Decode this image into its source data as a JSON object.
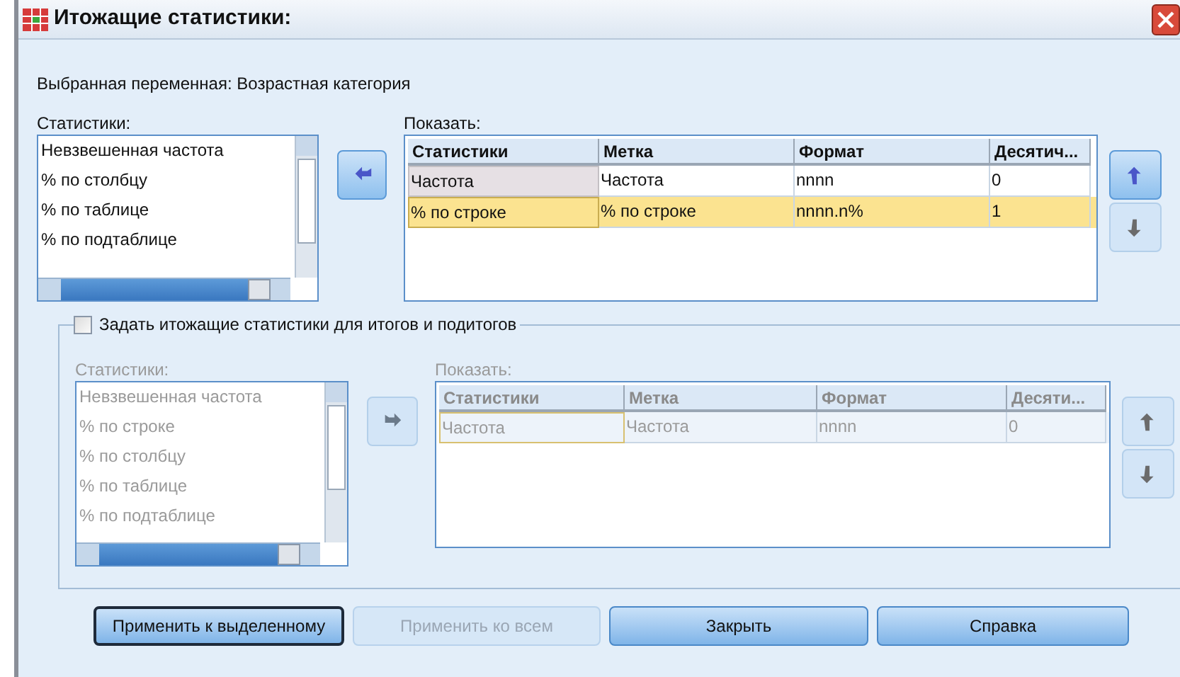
{
  "window": {
    "title": "Итожащие статистики:"
  },
  "selected_variable": "Выбранная переменная: Возрастная категория",
  "main": {
    "list_label": "Статистики:",
    "list_items": [
      "Невзвешенная частота",
      "% по столбцу",
      "% по таблице",
      "% по подтаблице"
    ],
    "table_label": "Показать:",
    "columns": [
      "Статистики",
      "Метка",
      "Формат",
      "Десятич..."
    ],
    "rows": [
      {
        "cells": [
          "Частота",
          "Частота",
          "nnnn",
          "0"
        ],
        "selected": false
      },
      {
        "cells": [
          "% по строке",
          "% по строке",
          "nnnn.n%",
          "1"
        ],
        "selected": true
      }
    ],
    "move_buttons": [
      {
        "kind": "up",
        "disabled": false
      },
      {
        "kind": "down",
        "disabled": true
      }
    ]
  },
  "subtotals": {
    "checkbox": {
      "label": "Задать итожащие статистики для итогов и подитогов",
      "checked": false
    },
    "list_label": "Статистики:",
    "list_items": [
      "Невзвешенная частота",
      "% по строке",
      "% по столбцу",
      "% по таблице",
      "% по подтаблице"
    ],
    "table_label": "Показать:",
    "columns": [
      "Статистики",
      "Метка",
      "Формат",
      "Десяти..."
    ],
    "rows": [
      {
        "cells": [
          "Частота",
          "Частота",
          "nnnn",
          "0"
        ],
        "selected": false
      }
    ],
    "move_buttons": [
      {
        "kind": "up",
        "disabled": true
      },
      {
        "kind": "down",
        "disabled": true
      }
    ]
  },
  "buttons": [
    {
      "label": "Применить к выделенному",
      "disabled": false,
      "default": true
    },
    {
      "label": "Применить ко всем",
      "disabled": true,
      "default": false
    },
    {
      "label": "Закрыть",
      "disabled": false,
      "default": false
    },
    {
      "label": "Справка",
      "disabled": false,
      "default": false
    }
  ]
}
